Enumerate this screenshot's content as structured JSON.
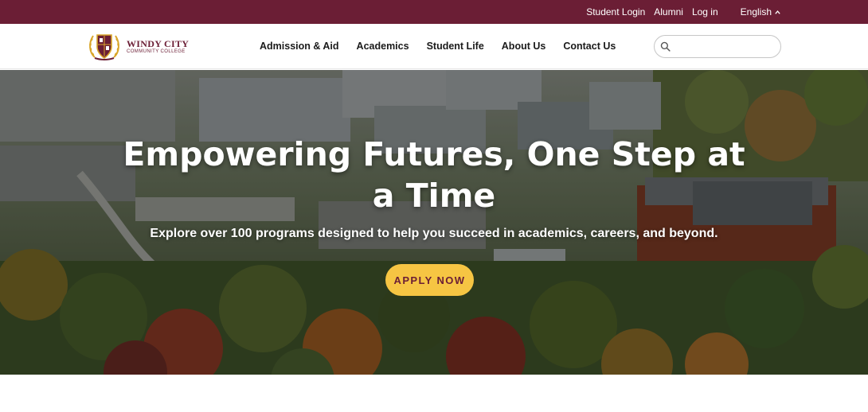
{
  "utility_bar": {
    "links": [
      "Student Login",
      "Alumni",
      "Log in"
    ],
    "language": "English",
    "language_icon": "chevron-up-icon",
    "color": "#6b1e35"
  },
  "header": {
    "logo": {
      "name": "WINDY CITY",
      "subtitle": "COMMUNITY COLLEGE",
      "crest_icon": "college-crest-icon"
    },
    "nav_items": [
      "Admission & Aid",
      "Academics",
      "Student Life",
      "About Us",
      "Contact Us"
    ],
    "search": {
      "placeholder": "",
      "value": "",
      "icon": "search-icon"
    }
  },
  "hero": {
    "title": "Empowering Futures, One Step at a Time",
    "subtitle": "Explore over 100 programs designed to help you succeed in academics, careers, and beyond.",
    "cta_label": "APPLY NOW",
    "cta_color": "#f6c543",
    "cta_text_color": "#6b1e35"
  }
}
